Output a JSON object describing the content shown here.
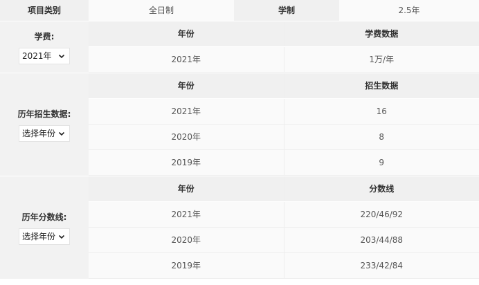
{
  "top": {
    "category_label": "项目类别",
    "category_value": "全日制",
    "duration_label": "学制",
    "duration_value": "2.5年"
  },
  "tuition": {
    "label": "学费:",
    "select_value": "2021年",
    "col_year": "年份",
    "col_value": "学费数据",
    "rows": [
      {
        "year": "2021年",
        "value": "1万/年"
      }
    ]
  },
  "enrollment": {
    "label": "历年招生数据:",
    "select_value": "选择年份",
    "col_year": "年份",
    "col_value": "招生数据",
    "rows": [
      {
        "year": "2021年",
        "value": "16"
      },
      {
        "year": "2020年",
        "value": "8"
      },
      {
        "year": "2019年",
        "value": "9"
      }
    ]
  },
  "scores": {
    "label": "历年分数线:",
    "select_value": "选择年份",
    "col_year": "年份",
    "col_value": "分数线",
    "rows": [
      {
        "year": "2021年",
        "value": "220/46/92"
      },
      {
        "year": "2020年",
        "value": "203/44/88"
      },
      {
        "year": "2019年",
        "value": "233/42/84"
      }
    ]
  }
}
